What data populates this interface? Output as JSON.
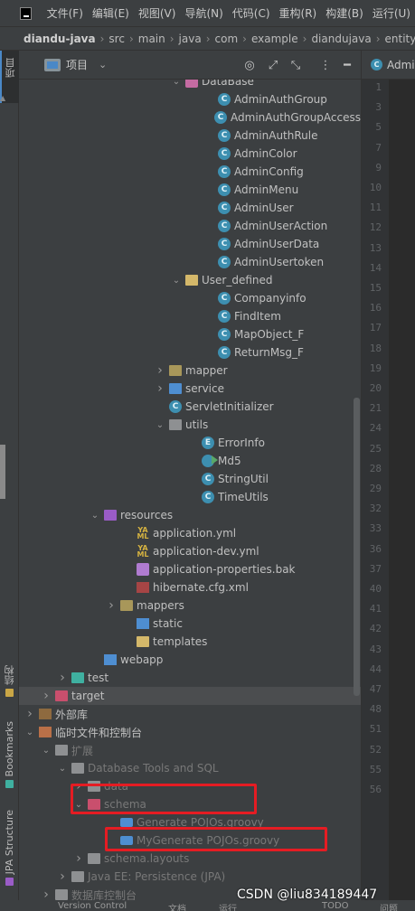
{
  "menubar": {
    "items": [
      "文件(F)",
      "编辑(E)",
      "视图(V)",
      "导航(N)",
      "代码(C)",
      "重构(R)",
      "构建(B)",
      "运行(U)"
    ]
  },
  "breadcrumb": [
    "diandu-java",
    "src",
    "main",
    "java",
    "com",
    "example",
    "diandujava",
    "entity"
  ],
  "left_strip": {
    "project_tab": "项目",
    "structure_tab": "结构",
    "bookmarks_tab": "Bookmarks",
    "jpa_tab": "JPA Structure"
  },
  "panel": {
    "title": "项目",
    "dropdown_icon": "chevron-down",
    "buttons": [
      "target-icon",
      "expand-icon",
      "collapse-icon",
      "more-icon",
      "minimize-icon"
    ]
  },
  "editor_tab": {
    "label": "Admi"
  },
  "line_numbers": [
    "1",
    "3",
    "5",
    "7",
    "9",
    "10",
    "11",
    "12",
    "13",
    "14",
    "15",
    "16",
    "17",
    "18",
    "19",
    "20",
    "21",
    "24",
    "25",
    "28",
    "29",
    "32",
    "33",
    "36",
    "37",
    "40",
    "41",
    "42",
    "43",
    "44",
    "47",
    "48",
    "51",
    "52",
    "55",
    "56"
  ],
  "tree": [
    {
      "depth": 9,
      "arrow": "down",
      "icon": "db",
      "label": "DataBase"
    },
    {
      "depth": 11,
      "icon": "class",
      "label": "AdminAuthGroup"
    },
    {
      "depth": 11,
      "icon": "class",
      "label": "AdminAuthGroupAccess"
    },
    {
      "depth": 11,
      "icon": "class",
      "label": "AdminAuthRule"
    },
    {
      "depth": 11,
      "icon": "class",
      "label": "AdminColor"
    },
    {
      "depth": 11,
      "icon": "class",
      "label": "AdminConfig"
    },
    {
      "depth": 11,
      "icon": "class",
      "label": "AdminMenu"
    },
    {
      "depth": 11,
      "icon": "class",
      "label": "AdminUser"
    },
    {
      "depth": 11,
      "icon": "class",
      "label": "AdminUserAction"
    },
    {
      "depth": 11,
      "icon": "class",
      "label": "AdminUserData"
    },
    {
      "depth": 11,
      "icon": "class",
      "label": "AdminUsertoken"
    },
    {
      "depth": 9,
      "arrow": "down",
      "icon": "folder-yellow",
      "label": "User_defined"
    },
    {
      "depth": 11,
      "icon": "class",
      "label": "Companyinfo"
    },
    {
      "depth": 11,
      "icon": "class",
      "label": "FindItem"
    },
    {
      "depth": 11,
      "icon": "class",
      "label": "MapObject_F"
    },
    {
      "depth": 11,
      "icon": "class",
      "label": "ReturnMsg_F"
    },
    {
      "depth": 8,
      "arrow": "right",
      "icon": "folder",
      "label": "mapper"
    },
    {
      "depth": 8,
      "arrow": "right",
      "icon": "folder-blue",
      "label": "service"
    },
    {
      "depth": 8,
      "icon": "class",
      "label": "ServletInitializer"
    },
    {
      "depth": 8,
      "arrow": "down",
      "icon": "folder-grey",
      "label": "utils"
    },
    {
      "depth": 10,
      "icon": "enum",
      "label": "ErrorInfo"
    },
    {
      "depth": 10,
      "icon": "runnable",
      "label": "Md5"
    },
    {
      "depth": 10,
      "icon": "class",
      "label": "StringUtil"
    },
    {
      "depth": 10,
      "icon": "class",
      "label": "TimeUtils"
    },
    {
      "depth": 4,
      "arrow": "down",
      "icon": "folder-purple",
      "label": "resources"
    },
    {
      "depth": 6,
      "icon": "yaml",
      "label": "application.yml"
    },
    {
      "depth": 6,
      "icon": "yaml",
      "label": "application-dev.yml"
    },
    {
      "depth": 6,
      "icon": "bak",
      "label": "application-properties.bak"
    },
    {
      "depth": 6,
      "icon": "xml",
      "label": "hibernate.cfg.xml"
    },
    {
      "depth": 5,
      "arrow": "right",
      "icon": "folder",
      "label": "mappers"
    },
    {
      "depth": 6,
      "icon": "web",
      "label": "static"
    },
    {
      "depth": 6,
      "icon": "folder-yellow",
      "label": "templates"
    },
    {
      "depth": 4,
      "icon": "web",
      "label": "webapp"
    },
    {
      "depth": 2,
      "arrow": "right",
      "icon": "folder-teal",
      "label": "test"
    },
    {
      "depth": 1,
      "arrow": "right",
      "icon": "folder-red",
      "label": "target",
      "selected": true
    },
    {
      "depth": 0,
      "arrow": "right",
      "icon": "libs",
      "label": "外部库"
    },
    {
      "depth": 0,
      "arrow": "down",
      "icon": "scratch",
      "label": "临时文件和控制台"
    },
    {
      "depth": 1,
      "arrow": "down",
      "icon": "folder-grey",
      "label": "扩展",
      "dim": true
    },
    {
      "depth": 2,
      "arrow": "down",
      "icon": "folder-grey",
      "label": "Database Tools and SQL",
      "dim": true
    },
    {
      "depth": 3,
      "arrow": "right",
      "icon": "folder-grey",
      "label": "data",
      "dim": true
    },
    {
      "depth": 3,
      "arrow": "down",
      "icon": "folder-red",
      "label": "schema",
      "dim": true
    },
    {
      "depth": 5,
      "icon": "groovy",
      "label": "Generate POJOs.groovy",
      "dim": true
    },
    {
      "depth": 5,
      "icon": "groovy",
      "label": "MyGenerate POJOs.groovy",
      "dim": true
    },
    {
      "depth": 3,
      "arrow": "right",
      "icon": "folder-grey",
      "label": "schema.layouts",
      "dim": true
    },
    {
      "depth": 2,
      "arrow": "right",
      "icon": "folder-grey",
      "label": "Java EE: Persistence (JPA)",
      "dim": true
    },
    {
      "depth": 1,
      "arrow": "right",
      "icon": "folder-grey",
      "label": "数据库控制台",
      "dim": true
    }
  ],
  "bottombar": [
    "Version Control",
    "文档",
    "运行",
    "TODO",
    "问题"
  ],
  "watermark": "CSDN @liu834189447",
  "colors": {
    "annotation": "#e51c23",
    "accent": "#4a88c7",
    "background": "#3c3f41"
  }
}
